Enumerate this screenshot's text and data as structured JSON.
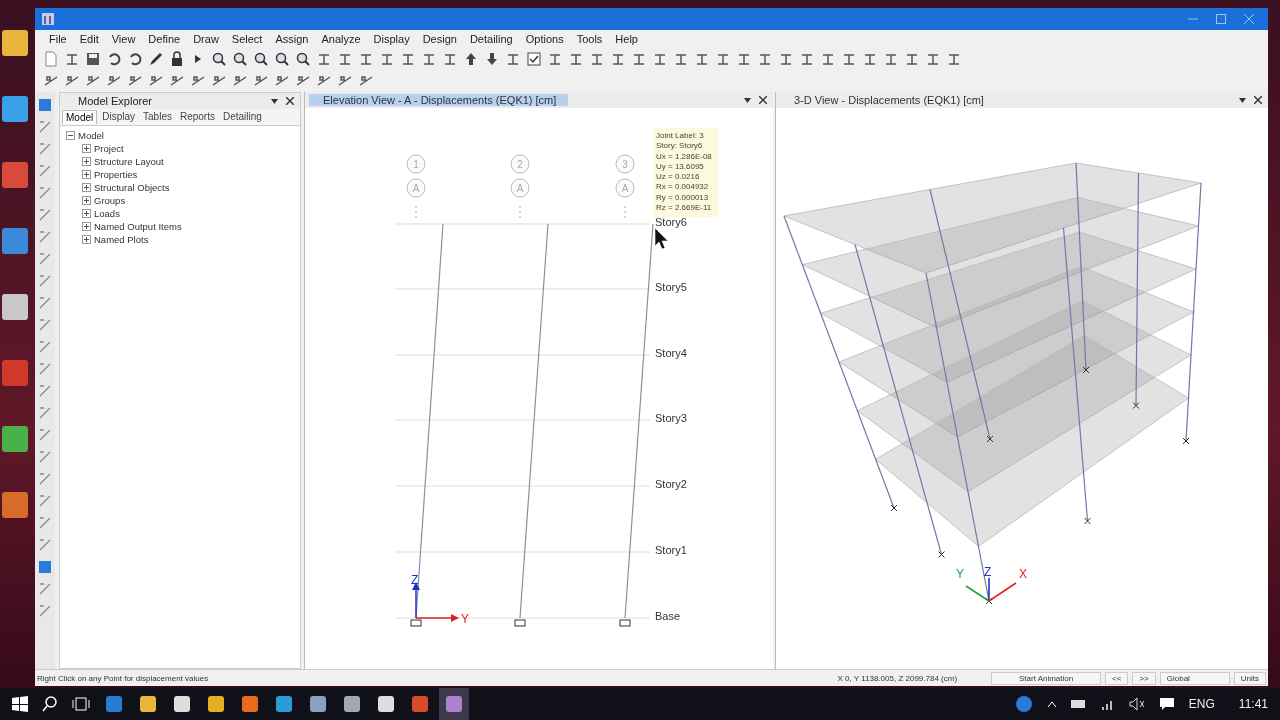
{
  "menu": [
    "File",
    "Edit",
    "View",
    "Define",
    "Draw",
    "Select",
    "Assign",
    "Analyze",
    "Display",
    "Design",
    "Detailing",
    "Options",
    "Tools",
    "Help"
  ],
  "model_explorer": {
    "title": "Model Explorer",
    "tabs": [
      {
        "label": "Model",
        "selected": true
      },
      {
        "label": "Display",
        "selected": false
      },
      {
        "label": "Tables",
        "selected": false
      },
      {
        "label": "Reports",
        "selected": false
      },
      {
        "label": "Detailing",
        "selected": false
      }
    ],
    "tree": {
      "label": "Model",
      "children": [
        {
          "label": "Project"
        },
        {
          "label": "Structure Layout"
        },
        {
          "label": "Properties"
        },
        {
          "label": "Structural Objects"
        },
        {
          "label": "Groups"
        },
        {
          "label": "Loads"
        },
        {
          "label": "Named Output Items"
        },
        {
          "label": "Named Plots"
        }
      ]
    }
  },
  "views": [
    {
      "title": "Elevation View - A   - Displacements (EQK1)  [cm]",
      "selected": true
    },
    {
      "title": "3-D View   - Displacements (EQK1)  [cm]",
      "selected": false
    }
  ],
  "elevation": {
    "gridlines": [
      {
        "number": "1",
        "letter": "A"
      },
      {
        "number": "2",
        "letter": "A"
      },
      {
        "number": "3",
        "letter": "A"
      }
    ],
    "stories": [
      "Story6",
      "Story5",
      "Story4",
      "Story3",
      "Story2",
      "Story1",
      "Base"
    ],
    "axes": [
      "Z",
      "Y"
    ],
    "tooltip": [
      "Joint Label: 3",
      "Story: Story6",
      "Ux = 1.286E-08",
      "Uy = 13.6095",
      "Uz = 0.0216",
      "Rx = 0.004932",
      "Ry = 0.000013",
      "Rz = 2.669E-11"
    ]
  },
  "view3d": {
    "axes": [
      "Y",
      "Z",
      "X"
    ]
  },
  "status_bar": {
    "hint": "Right Click on any Point for displacement values",
    "coordinates": "X 0, Y 1138.005, Z 2099.784 (cm)",
    "animation_button": "Start Animation",
    "prev_button": "<<",
    "next_button": ">>",
    "coordinate_system": "Global",
    "units_button": "Units"
  },
  "taskbar": {
    "language": "ENG",
    "time": "11:41"
  }
}
